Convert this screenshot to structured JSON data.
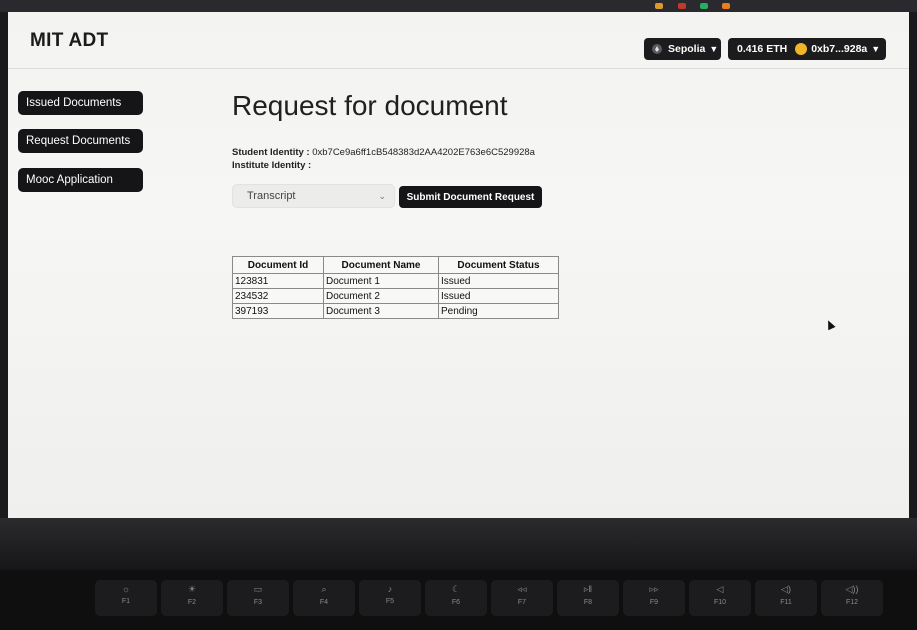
{
  "app": {
    "brand": "MIT ADT"
  },
  "header": {
    "network_label": "Sepolia",
    "balance": "0.416 ETH",
    "account": "0xb7...928a"
  },
  "sidebar": {
    "items": [
      {
        "label": "Issued Documents"
      },
      {
        "label": "Request Documents"
      },
      {
        "label": "Mooc Application"
      }
    ]
  },
  "main": {
    "title": "Request for document",
    "student_identity_label": "Student Identity :",
    "student_identity_value": "0xb7Ce9a6ff1cB548383d2AA4202E763e6C529928a",
    "institute_identity_label": "Institute Identity :",
    "document_select_value": "Transcript",
    "submit_label": "Submit Document Request"
  },
  "table": {
    "headers": [
      "Document Id",
      "Document Name",
      "Document Status"
    ],
    "rows": [
      [
        "123831",
        "Document 1",
        "Issued"
      ],
      [
        "234532",
        "Document 2",
        "Issued"
      ],
      [
        "397193",
        "Document 3",
        "Pending"
      ]
    ]
  },
  "keyboard": {
    "fkeys": [
      "F1",
      "F2",
      "F3",
      "F4",
      "F5",
      "F6",
      "F7",
      "F8",
      "F9",
      "F10",
      "F11",
      "F12"
    ]
  }
}
